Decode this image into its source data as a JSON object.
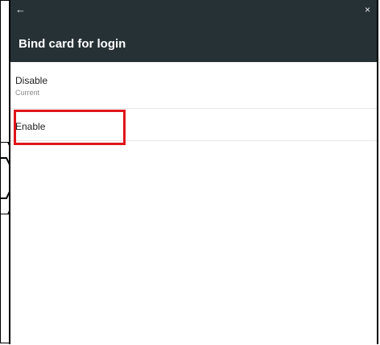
{
  "header": {
    "title": "Bind card for login",
    "back_icon": "←",
    "close_icon": "×"
  },
  "options": [
    {
      "label": "Disable",
      "sublabel": "Current"
    },
    {
      "label": "Enable"
    }
  ],
  "colors": {
    "titlebar": "#263135",
    "highlight": "#e1141b"
  }
}
